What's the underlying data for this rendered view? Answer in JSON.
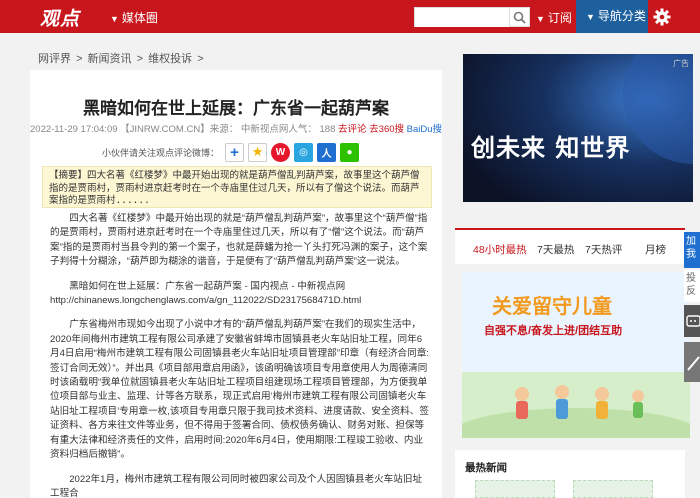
{
  "header": {
    "logo": "观点",
    "media_menu": "媒体圈",
    "search_placeholder": "",
    "subscribe": "订阅",
    "nav_category": "导航分类",
    "colors": {
      "brand_red": "#c8161d",
      "nav_blue": "#1e5f9e"
    }
  },
  "breadcrumb": [
    "网评界",
    ">",
    "新闻资讯",
    ">",
    "维权投诉",
    ">"
  ],
  "article": {
    "title": "黑暗如何在世上延展：广东省一起葫芦案",
    "date": "2022-11-29 17:04:09",
    "source": "【JINRW.COM.CN】",
    "source_label": "来源：",
    "author": "中新视点网人气：",
    "views": "188",
    "comment_link": "去评论",
    "baidu_link": "去360搜",
    "baidu2_link": "BaiDu搜",
    "share_label": "小伙伴请关注观点评论微博：",
    "summary": "【摘要】四大名著《红楼梦》中最开始出现的就是葫芦僧乱判葫芦案，故事里这个葫芦僧指的是贾雨村，贾雨村进京赶考时在一个寺庙里住过几天，所以有了僧这个说法。而葫芦案指的是贾雨村......",
    "paragraphs": [
      "四大名著《红楼梦》中最开始出现的就是“葫芦僧乱判葫芦案”，故事里这个“葫芦僧”指的是贾雨村，贾雨村进京赶考时在一个寺庙里住过几天，所以有了“僧”这个说法。而“葫芦案”指的是贾雨村当县令判的第一个案子，也就是薛蟠为抢一丫头打死冯渊的案子，这个案子判得十分糊涂，“葫芦即为糊涂的谐音，于是便有了“葫芦僧乱判葫芦案”这一说法。",
      "黑暗如何在世上延展：广东省一起葫芦案 - 国内视点 - 中新视点网 http://chinanews.longchenglaws.com/a/gn_112022/SD2317568471D.html",
      "广东省梅州市现如今出现了小说中才有的“葫芦僧乱判葫芦案”在我们的现实生活中，2020年间梅州市建筑工程有限公司承建了安徽省蚌埠市固镇县老火车站旧址工程，同年6月4日启用“梅州市建筑工程有限公司固镇县老火车站旧址项目管理部”印章（有经济合同章:签订合同无效）”。并出具《项目部用章启用函》，该函明确该项目专用章使用人为周德清同时该函载明“我单位就固镇县老火车站旧址工程项目组建现场工程项目管理部，为方便我单位项目部与业主、监理、计等各方联系，现正式启用‘梅州市建筑工程有限公司固镇老火车站旧址工程项目’专用章一枚,该项目专用章只限于我司技术资料、进度请款、安全资料、签证资料、各方来往文件等业务，但不得用于签署合同、债权债务确认、财务对账、担保等有重大法律和经济责任的文件，启用时间:2020年6月4日，使用期限:工程竣工验收、内业资料归档后撤销”。",
      "2022年1月，梅州市建筑工程有限公司同时被四家公司及个人因固镇县老火车站旧址工程合"
    ]
  },
  "sidebar": {
    "ad_top_text": "创未来 知世界",
    "ad_top_tag": "广告",
    "tabs": [
      "48小时最热",
      "7天最热",
      "7天热评",
      "月榜"
    ],
    "ad_mid_title": "关爱留守儿童",
    "ad_mid_slogan": "自强不息/奋发上进/团结互助",
    "latest_title": "最热新闻"
  },
  "float": {
    "blue_label": "加我",
    "white_label": "投反"
  }
}
